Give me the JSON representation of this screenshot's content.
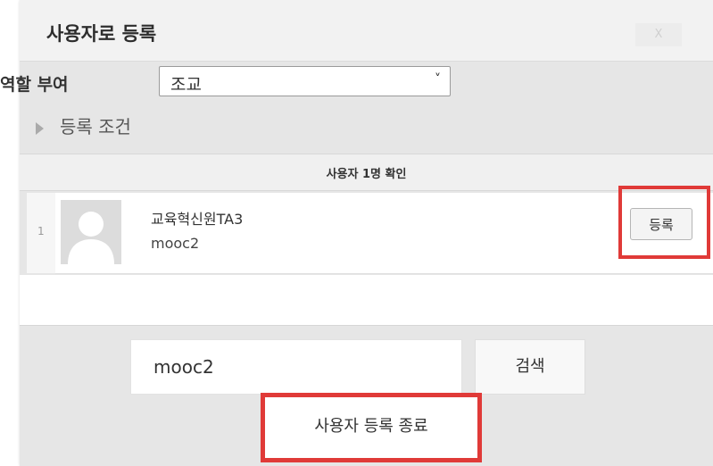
{
  "dialog": {
    "title": "사용자로 등록",
    "close_label": "X"
  },
  "role": {
    "label": "역할 부여",
    "selected": "조교"
  },
  "conditions": {
    "label": "등록 조건"
  },
  "results": {
    "count_label": "사용자 1명 확인",
    "rows": [
      {
        "index": "1",
        "name": "교육혁신원TA3",
        "username": "mooc2",
        "enrol_label": "등록"
      }
    ]
  },
  "search": {
    "value": "mooc2",
    "button_label": "검색"
  },
  "footer": {
    "finish_label": "사용자 등록 종료"
  },
  "colors": {
    "highlight": "#e03a38",
    "dialog_background": "#e6e6e6"
  }
}
